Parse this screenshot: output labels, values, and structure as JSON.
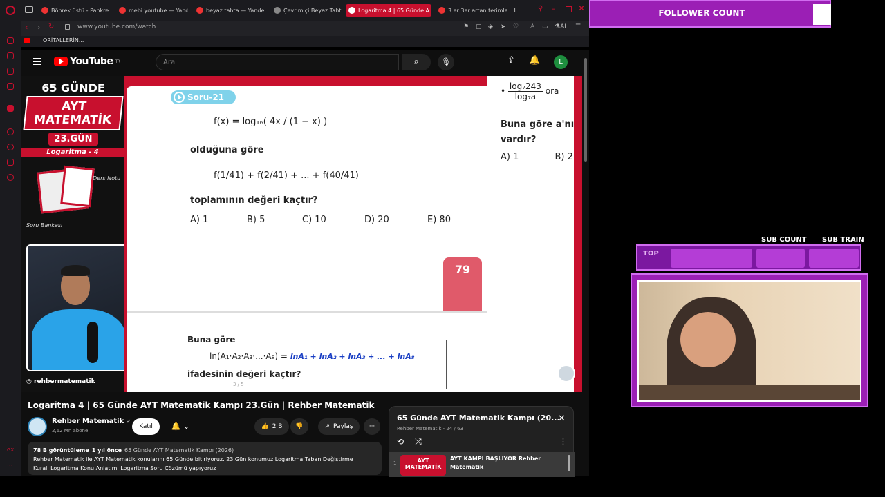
{
  "browser": {
    "tabs": [
      {
        "label": "Böbrek üstü - Pankre"
      },
      {
        "label": "mebi youtube — Yand"
      },
      {
        "label": "beyaz tahta — Yande"
      },
      {
        "label": "Çevrimiçi Beyaz Taht"
      },
      {
        "label": "Logaritma 4 | 65 Günde A"
      },
      {
        "label": "3 er 3er artan terimler"
      }
    ],
    "url": "www.youtube.com/watch",
    "bookmark": "ORİTALLERİN..."
  },
  "youtube": {
    "logo": "YouTube",
    "region": "TR",
    "search_placeholder": "Ara",
    "avatar_letter": "L"
  },
  "video": {
    "badge": {
      "top": "65 GÜNDE",
      "title": "AYT MATEMATİK",
      "day": "23.GÜN"
    },
    "topic": "Logaritma - 4",
    "ders_notu": "Ders Notu",
    "soru_bankasi": "Soru Bankası",
    "handle": "rehbermatematik",
    "page_counter": "3 / 5",
    "question": {
      "tag": "Soru-21",
      "func": "f(x) = log₁₆( 4x / (1 − x) )",
      "line1": "olduğuna göre",
      "sum": "f(1/41) + f(2/41) + ... + f(40/41)",
      "line2": "toplamının değeri kaçtır?",
      "answers": [
        "A) 1",
        "B) 5",
        "C) 10",
        "D) 20",
        "E) 80"
      ]
    },
    "page_number": "79",
    "q2": {
      "lead": "Buna göre",
      "expr": "ln(A₁·A₂·A₃·...·A₈) =",
      "handwriting": "lnA₁ + lnA₂ + lnA₃ + ... + lnA₈",
      "tail": "ifadesinin değeri kaçtır?"
    },
    "right_page": {
      "frac_top": "log₇243",
      "frac_bottom": "log₇a",
      "frac_suffix": "ora",
      "text1": "Buna göre a'nın",
      "text2": "vardır?",
      "ans_a": "A) 1",
      "ans_b": "B) 2"
    }
  },
  "watch": {
    "title": "Logaritma 4 | 65 Günde AYT Matematik Kampı 23.Gün | Rehber Matematik",
    "channel": "Rehber Matematik",
    "subs": "2,62 Mn abone",
    "join": "Katıl",
    "likes": "2 B",
    "share": "Paylaş",
    "views": "78 B görüntüleme",
    "age": "1 yıl önce",
    "playlist_link": "65 Günde AYT Matematik Kampı (2026)",
    "desc_line1": "Rehber Matematik ile AYT Matematik konularını 65 Günde bitiriyoruz. 23.Gün konumuz Logaritma Taban Değiştirme",
    "desc_line2": "Kuralı Logaritma Konu Anlatımı Logaritma Soru Çözümü yapıyoruz"
  },
  "playlist": {
    "title": "65 Günde AYT Matematik Kampı (20...",
    "subtitle": "Rehber Matematik - 24 / 63",
    "first_index": "1",
    "first_thumb": "AYT MATEMATİK",
    "first_title": "AYT KAMPI BAŞLIYOR Rehber Matematik"
  },
  "stream": {
    "follower_label": "FOLLOWER COUNT",
    "sub_count": "SUB COUNT",
    "sub_train": "SUB TRAIN",
    "top_label": "TOP"
  }
}
